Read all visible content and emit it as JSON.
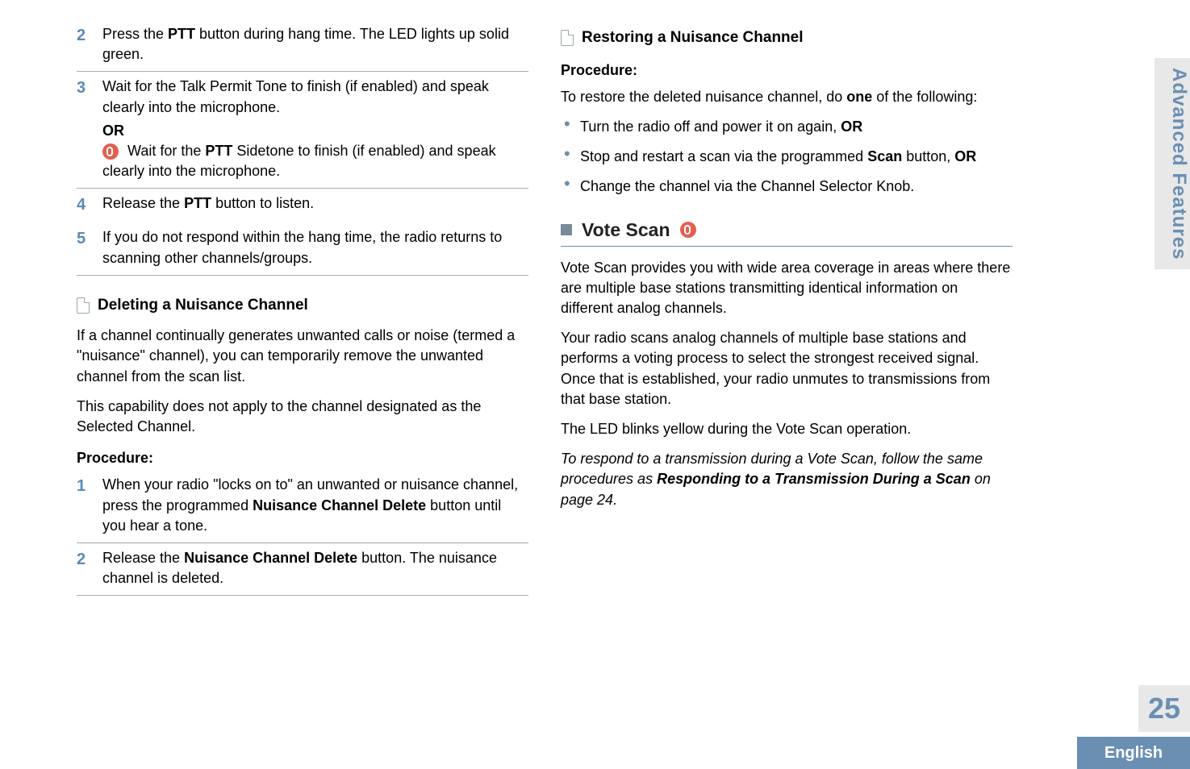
{
  "sideTab": "Advanced Features",
  "pageNumber": "25",
  "footerLang": "English",
  "left": {
    "steps": [
      {
        "num": "2",
        "text_a": "Press the ",
        "bold1": "PTT",
        "text_b": " button during hang time. The LED lights up solid green."
      },
      {
        "num": "3",
        "text_a": "Wait for the Talk Permit Tone to finish (if enabled) and speak clearly into the microphone.",
        "or": "OR",
        "sub_a": " Wait for the ",
        "sub_bold": "PTT",
        "sub_b": " Sidetone to finish (if enabled) and speak clearly into the microphone."
      },
      {
        "num": "4",
        "text_a": "Release the ",
        "bold1": "PTT",
        "text_b": " button to listen."
      },
      {
        "num": "5",
        "text_a": "If you do not respond within the hang time, the radio returns to scanning other channels/groups."
      }
    ],
    "sub1_title": "Deleting a Nuisance Channel",
    "sub1_p1": "If a channel continually generates unwanted calls or noise (termed a \"nuisance\" channel), you can temporarily remove the unwanted channel from the scan list.",
    "sub1_p2": "This capability does not apply to the channel designated as the Selected Channel.",
    "procLabel": "Procedure:",
    "procSteps": [
      {
        "num": "1",
        "pre": "When your radio \"locks on to\" an unwanted or nuisance channel, press the programmed ",
        "bold": "Nuisance Channel Delete",
        "post": " button until you hear a tone."
      },
      {
        "num": "2",
        "pre": "Release the ",
        "bold": "Nuisance Channel Delete",
        "post": " button. The nuisance channel is deleted."
      }
    ]
  },
  "right": {
    "sub2_title": "Restoring a Nuisance Channel",
    "procLabel": "Procedure:",
    "restoreIntro_a": "To restore the deleted nuisance channel, do ",
    "restoreIntro_bold": "one",
    "restoreIntro_b": " of the following:",
    "bullets": [
      {
        "pre": "Turn the radio off and power it on again, ",
        "bold": "OR"
      },
      {
        "pre": "Stop and restart a scan via the programmed ",
        "boldmid": "Scan",
        "mid": " button, ",
        "bold": "OR"
      },
      {
        "pre": "Change the channel via the Channel Selector Knob."
      }
    ],
    "voteTitle": "Vote Scan",
    "vote_p1": "Vote Scan provides you with wide area coverage in areas where there are multiple base stations transmitting identical information on different analog channels.",
    "vote_p2": "Your radio scans analog channels of multiple base stations and performs a voting process to select the strongest received signal. Once that is established, your radio unmutes to transmissions from that base station.",
    "vote_p3": "The LED blinks yellow during the Vote Scan operation.",
    "vote_it_a": "To respond to a transmission during a Vote Scan, follow the same procedures as ",
    "vote_it_bold": "Responding to a Transmission During a Scan",
    "vote_it_b": " on page 24."
  }
}
